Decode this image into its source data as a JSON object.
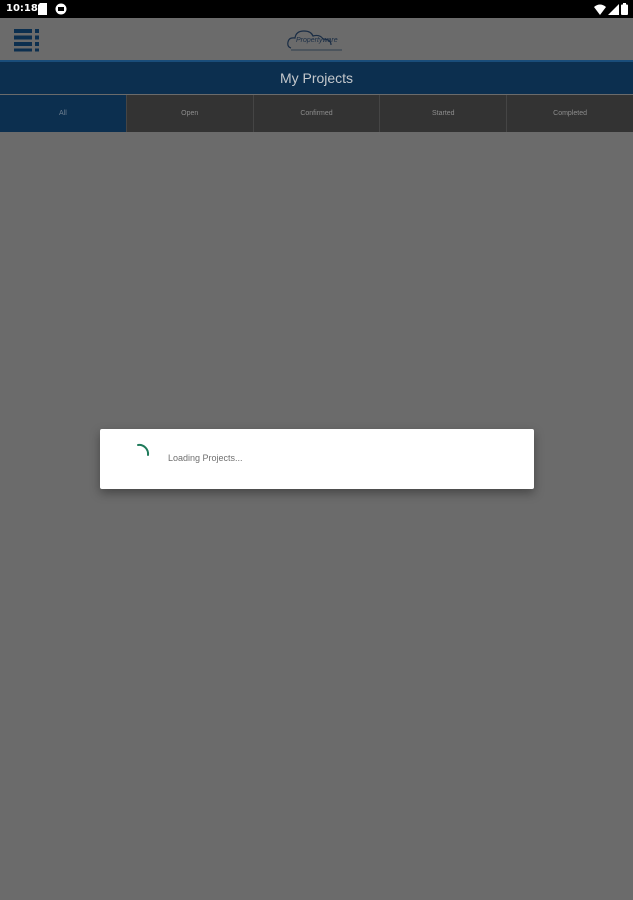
{
  "statusbar": {
    "time": "10:18",
    "icons": [
      "sim-card-icon",
      "app-notification-icon",
      "wifi-icon",
      "signal-icon",
      "battery-icon"
    ]
  },
  "appbar": {
    "menu_icon": "menu-grid-icon",
    "logo_text": "Propertyware"
  },
  "page": {
    "title": "My Projects"
  },
  "tabs": [
    {
      "label": "All",
      "active": true
    },
    {
      "label": "Open",
      "active": false
    },
    {
      "label": "Confirmed",
      "active": false
    },
    {
      "label": "Started",
      "active": false
    },
    {
      "label": "Completed",
      "active": false
    }
  ],
  "dialog": {
    "message": "Loading Projects..."
  },
  "colors": {
    "header": "#0c2f4f",
    "background": "#6b6b6b",
    "tab_inactive": "#333333",
    "spinner": "#1e7a5a"
  }
}
